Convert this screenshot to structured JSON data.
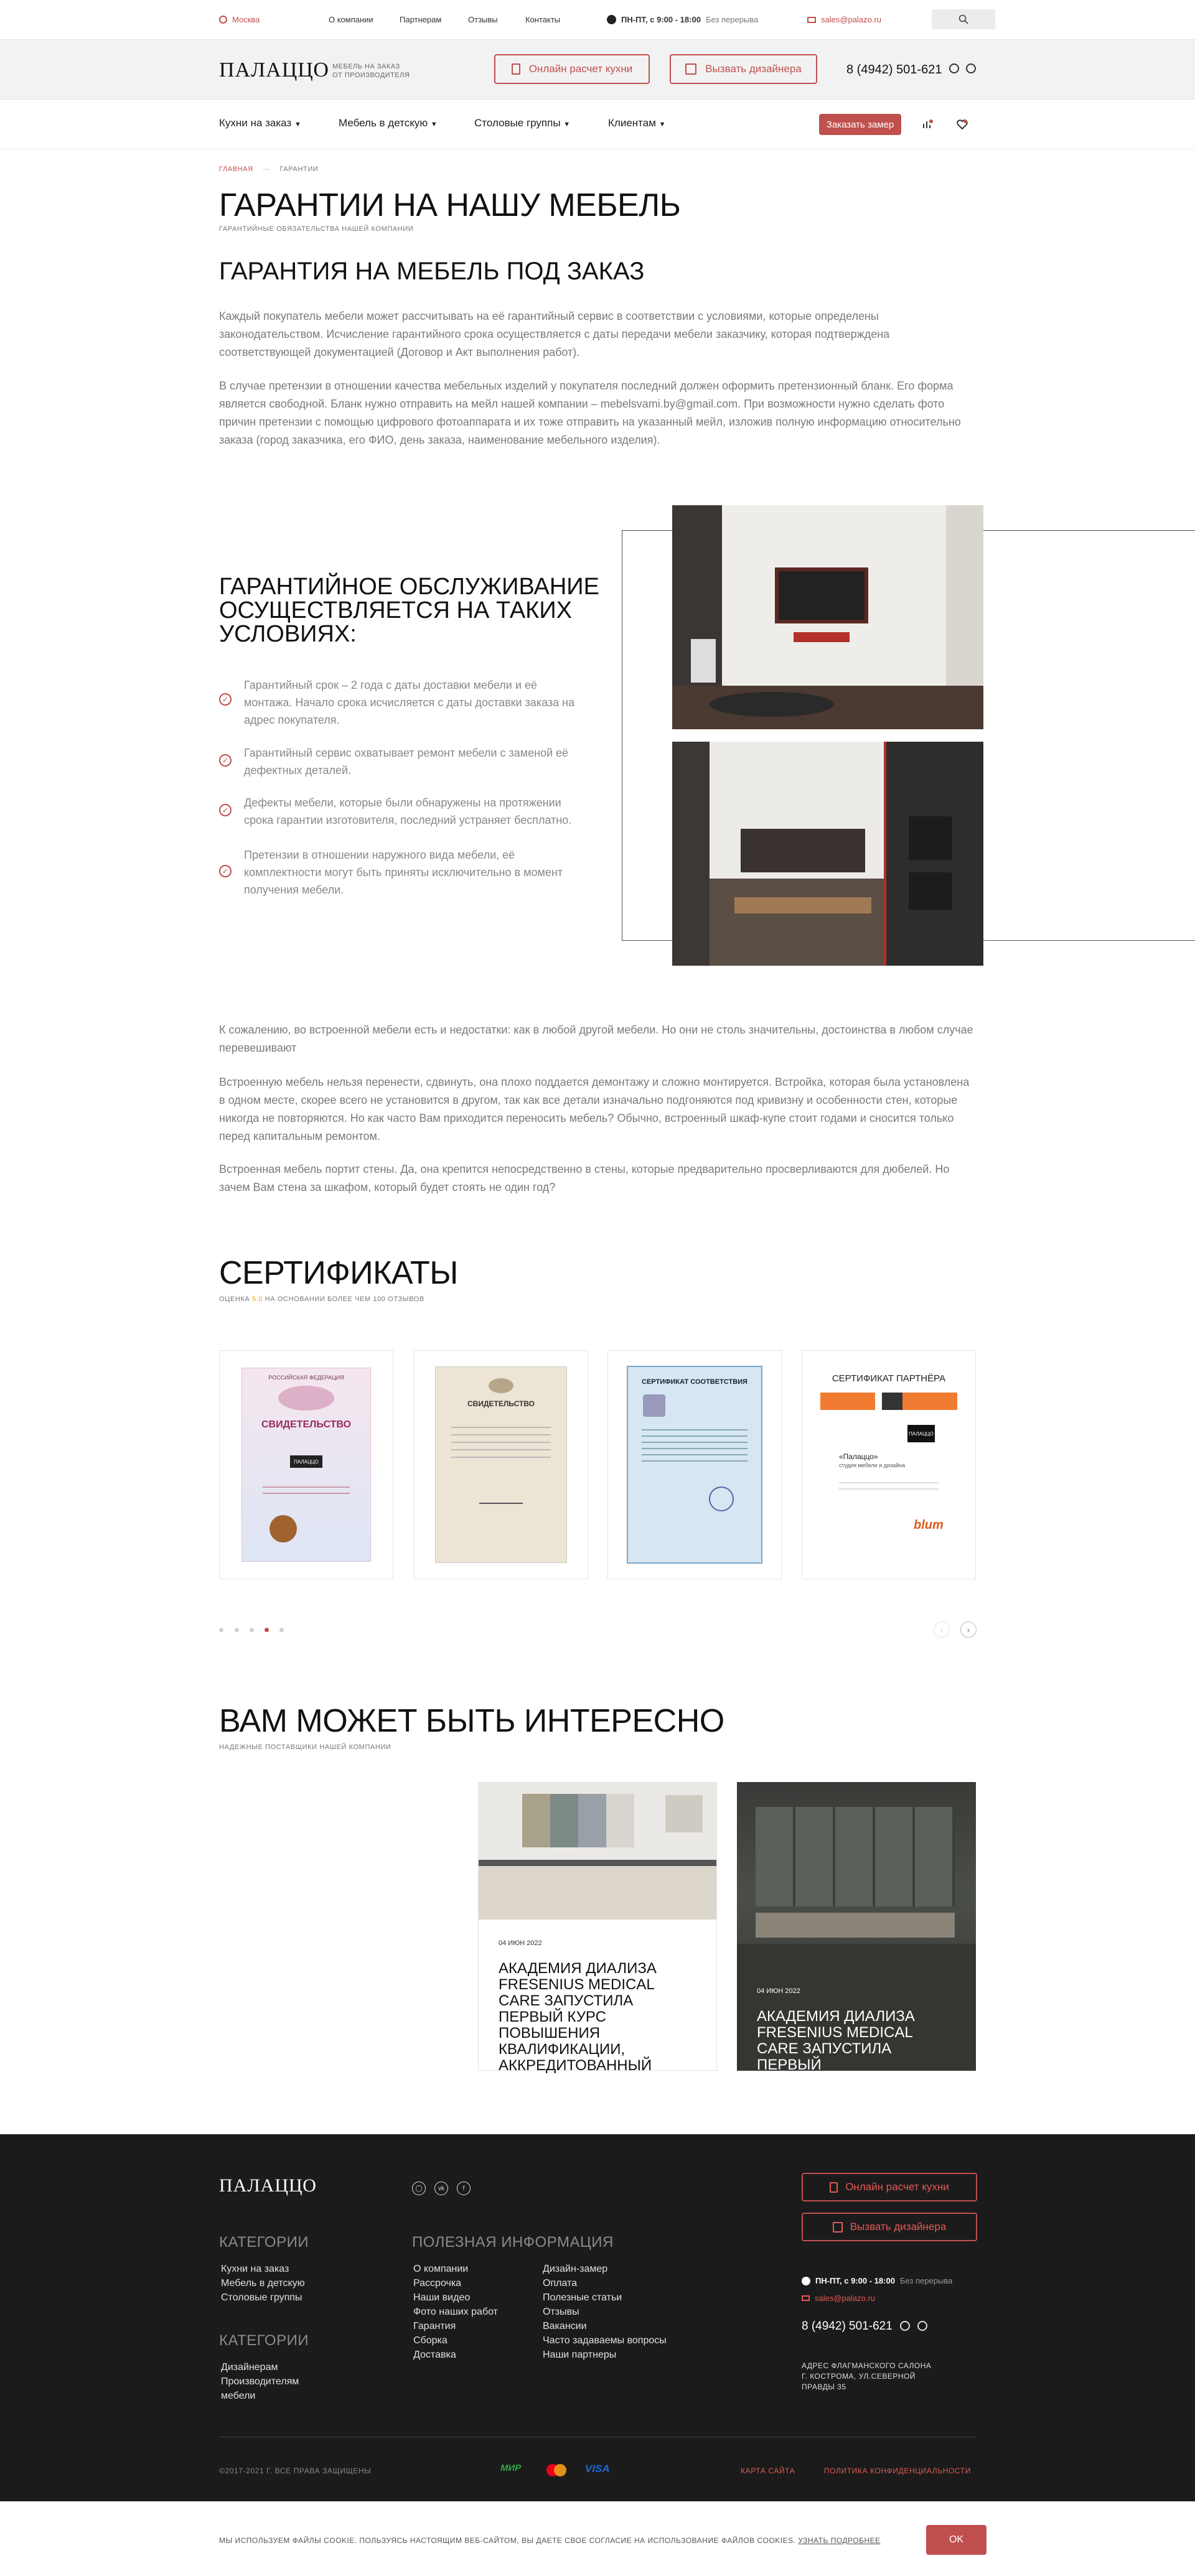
{
  "topbar": {
    "city": "Москва",
    "nav": [
      "О компании",
      "Партнерам",
      "Отзывы",
      "Контакты"
    ],
    "hours": "ПН-ПТ, с 9:00 - 18:00",
    "hours_note": "Без перерыва",
    "email": "sales@palazo.ru"
  },
  "header": {
    "logo": "ПАЛАЦЦО",
    "tagline_line1": "МЕБЕЛЬ НА ЗАКАЗ",
    "tagline_line2": "ОТ ПРОИЗВОДИТЕЛЯ",
    "btn_calc": "Онлайн расчет кухни",
    "btn_designer": "Вызвать дизайнера",
    "phone": "8 (4942) 501-621"
  },
  "navbar": {
    "items": [
      "Кухни на заказ",
      "Мебель в детскую",
      "Столовые группы",
      "Клиентам"
    ],
    "cta": "Заказать замер"
  },
  "breadcrumb": {
    "home": "ГЛАВНАЯ",
    "current": "ГАРАНТИИ"
  },
  "page": {
    "title": "ГАРАНТИИ НА НАШУ МЕБЕЛЬ",
    "subtitle": "ГАРАНТИЙНЫЕ ОБЯЗАТЕЛЬСТВА НАШЕЙ КОМПАНИИ",
    "section1_title": "ГАРАНТИЯ НА МЕБЕЛЬ ПОД ЗАКАЗ",
    "para1": "Каждый покупатель мебели может рассчитывать на её гарантийный сервис в соответствии с условиями, которые определены законодательством. Исчисление гарантийного срока осуществляется с даты передачи мебели заказчику, которая подтверждена соответствующей документацией (Договор и Акт выполнения работ).",
    "para2": "В случае претензии в отношении качества мебельных изделий у покупателя последний должен оформить претензионный бланк. Его форма является свободной. Бланк нужно отправить на мейл нашей компании – mebelsvami.by@gmail.com. При возможности нужно сделать фото причин претензии с помощью цифрового фотоаппарата и их тоже отправить на указанный мейл, изложив полную информацию относительно заказа (город заказчика, его ФИО, день заказа, наименование мебельного изделия).",
    "section2_title_l1": "ГАРАНТИЙНОЕ ОБСЛУЖИВАНИЕ",
    "section2_title_l2": "ОСУЩЕСТВЛЯЕТСЯ НА ТАКИХ",
    "section2_title_l3": "УСЛОВИЯХ:",
    "conditions": [
      [
        "Гарантийный срок – 2 года с даты доставки мебели и её",
        "монтажа. Начало срока исчисляется с даты доставки заказа на",
        "адрес покупателя."
      ],
      [
        "Гарантийный сервис охватывает ремонт мебели с заменой её",
        "дефектных деталей."
      ],
      [
        "Дефекты мебели, которые были обнаружены на протяжении",
        "срока гарантии изготовителя, последний устраняет бесплатно."
      ],
      [
        "Претензии в отношении наружного вида мебели, её",
        "комплектности могут быть приняты исключительно в момент",
        "получения мебели."
      ]
    ],
    "para3": "К сожалению, во встроенной мебели есть и недостатки: как в любой другой мебели. Но они не столь значительны, достоинства в любом случае перевешивают",
    "para4": "Встроенную мебель нельзя перенести, сдвинуть, она плохо поддается демонтажу и сложно монтируется. Встройка, которая была установлена в одном месте, скорее всего не установится в другом, так как все детали изначально подгоняются под кривизну и особенности стен, которые никогда не повторяются. Но как часто Вам приходится переносить мебель? Обычно, встроенный шкаф-купе стоит годами и сносится только перед капитальным ремонтом.",
    "para5": "Встроенная мебель портит стены. Да, она крепится непосредственно в стены, которые предварительно просверливаются для дюбелей. Но зачем Вам стена за шкафом, который будет стоять не один год?"
  },
  "certificates": {
    "title": "СЕРТИФИКАТЫ",
    "subtitle_pre": "ОЦЕНКА",
    "subtitle_rating": "5.0",
    "subtitle_post": "НА ОСНОВАНИИ БОЛЕЕ ЧЕМ 100 ОТЗЫВОВ",
    "cert1_header": "РОССИЙСКАЯ ФЕДЕРАЦИЯ",
    "cert1_title": "СВИДЕТЕЛЬСТВО",
    "cert1_stamp": "ПАЛАЦЦО",
    "cert2_title": "СВИДЕТЕЛЬСТВО",
    "cert3_title": "СЕРТИФИКАТ СООТВЕТСТВИЯ",
    "cert4_title": "СЕРТИФИКАТ ПАРТНЁРА",
    "cert4_company": "«Палаццо»",
    "cert4_sub": "студия мебели и дизайна",
    "cert4_logo": "ПАЛАЦЦО",
    "cert4_brand": "blum",
    "active_dot": 3
  },
  "interesting": {
    "title": "ВАМ МОЖЕТ БЫТЬ ИНТЕРЕСНО",
    "subtitle": "НАДЕЖНЫЕ ПОСТАВЩИКИ НАШЕЙ КОМПАНИИ",
    "card1_date": "04 ИЮН 2022",
    "card1_title": "АКАДЕМИЯ ДИАЛИЗА FRESENIUS MEDICAL CARE ЗАПУСТИЛА ПЕРВЫЙ КУРС ПОВЫШЕНИЯ КВАЛИФИКАЦИИ, АККРЕДИТОВАННЫЙ",
    "card2_date": "04 ИЮН 2022",
    "card2_title": "АКАДЕМИЯ ДИАЛИЗА FRESENIUS MEDICAL CARE ЗАПУСТИЛА ПЕРВЫЙ"
  },
  "footer": {
    "logo": "ПАЛАЦЦО",
    "categories_title": "КАТЕГОРИИ",
    "categories": [
      "Кухни на заказ",
      "Мебель в детскую",
      "Столовые группы"
    ],
    "categories2_title": "КАТЕГОРИИ",
    "categories2": [
      "Дизайнерам",
      "Производителям",
      "мебели"
    ],
    "info_title": "ПОЛЕЗНАЯ ИНФОРМАЦИЯ",
    "info_col1": [
      "О компании",
      "Рассрочка",
      "Наши видео",
      "Фото наших работ",
      "Гарантия",
      "Сборка",
      "Доставка"
    ],
    "info_col2": [
      "Дизайн-замер",
      "Оплата",
      "Полезные статьи",
      "Отзывы",
      "Вакансии",
      "Часто задаваемы вопросы",
      "Наши партнеры"
    ],
    "btn_calc": "Онлайн расчет кухни",
    "btn_designer": "Вызвать дизайнера",
    "hours": "ПН-ПТ, с 9:00 - 18:00",
    "hours_note": "Без перерыва",
    "email": "sales@palazo.ru",
    "phone": "8 (4942) 501-621",
    "address_l1": "АДРЕС ФЛАГМАНСКОГО САЛОНА",
    "address_l2": "Г. КОСТРОМА, УЛ.СЕВЕРНОЙ",
    "address_l3": "ПРАВДЫ 35",
    "copyright": "©2017-2021 Г. ВСЕ ПРАВА ЗАЩИЩЕНЫ",
    "pay_mir": "МИР",
    "pay_visa": "VISA",
    "sitemap": "КАРТА САЙТА",
    "privacy": "ПОЛИТИКА КОНФИДЕНЦИАЛЬНОСТИ"
  },
  "cookie": {
    "text": "МЫ ИСПОЛЬЗУЕМ ФАЙЛЫ COOKIE. ПОЛЬЗУЯСЬ НАСТОЯЩИМ ВЕБ-САЙТОМ, ВЫ ДАЕТЕ СВОЕ СОГЛАСИЕ НА ИСПОЛЬЗОВАНИЕ ФАЙЛОВ COOKIES.",
    "link": "УЗНАТЬ ПОДРОБНЕЕ",
    "button": "OK"
  },
  "colors": {
    "accent": "#c0504d",
    "footer_bg": "#1b1b1b"
  }
}
